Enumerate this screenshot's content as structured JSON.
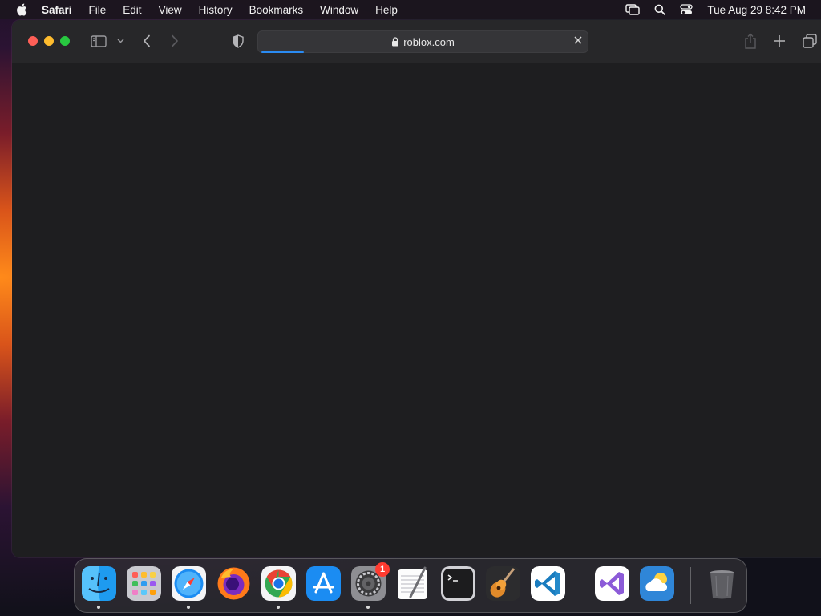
{
  "menubar": {
    "app_name": "Safari",
    "items": [
      "File",
      "Edit",
      "View",
      "History",
      "Bookmarks",
      "Window",
      "Help"
    ],
    "clock": "Tue Aug 29  8:42 PM"
  },
  "browser": {
    "url": "roblox.com",
    "load_progress": 0.13
  },
  "dock": {
    "apps": [
      "Finder",
      "Launchpad",
      "Safari",
      "Firefox",
      "Google Chrome",
      "App Store",
      "System Settings",
      "TextEdit",
      "Terminal",
      "GarageBand",
      "Visual Studio Code",
      "Visual Studio",
      "Weather",
      "Trash"
    ],
    "running": [
      "Finder",
      "Safari",
      "Google Chrome",
      "System Settings"
    ],
    "settings_badge": "1"
  }
}
